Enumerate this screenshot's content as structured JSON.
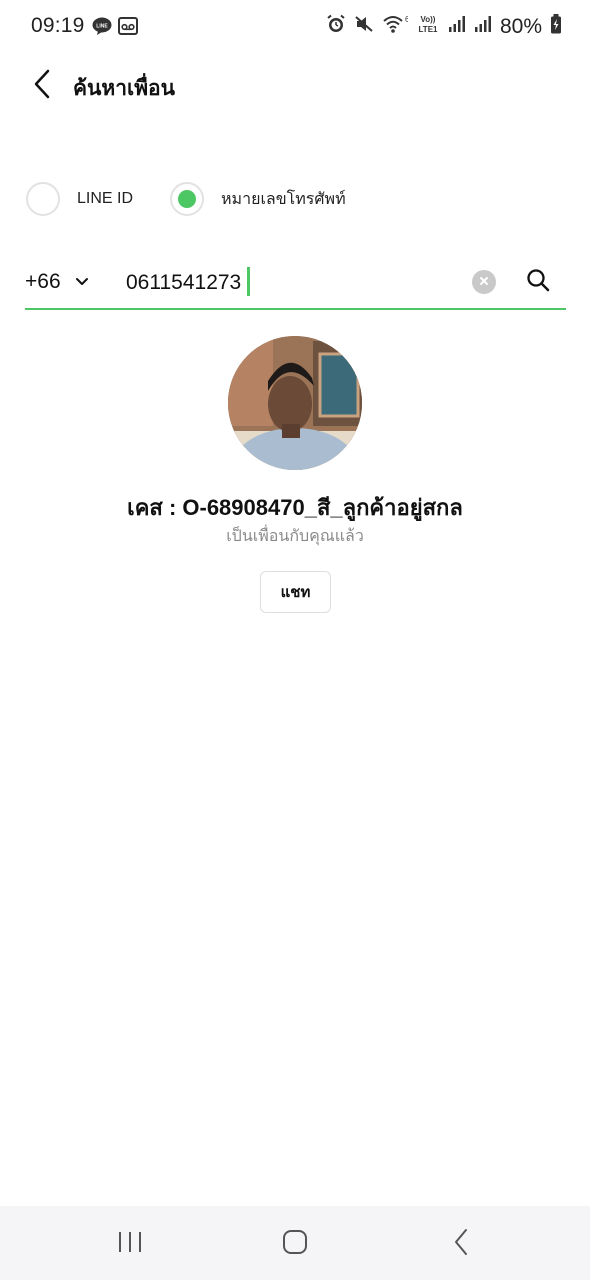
{
  "status_bar": {
    "time": "09:19",
    "battery": "80%",
    "icons": [
      "line-notification-icon",
      "voicemail-icon",
      "alarm-icon",
      "mute-icon",
      "wifi-icon",
      "volte-icon",
      "signal-icon",
      "signal-icon",
      "battery-charging-icon"
    ]
  },
  "header": {
    "title": "ค้นหาเพื่อน"
  },
  "search_type": {
    "options": [
      {
        "label": "LINE ID",
        "selected": false
      },
      {
        "label": "หมายเลขโทรศัพท์",
        "selected": true
      }
    ]
  },
  "search": {
    "country_code": "+66",
    "value": "0611541273"
  },
  "result": {
    "name": "เคส : O-68908470_สี_ลูกค้าอยู่สกล",
    "status": "เป็นเพื่อนกับคุณแล้ว",
    "chat_label": "แชท"
  },
  "colors": {
    "accent": "#4cc764",
    "nav_background": "#f5f5f7"
  }
}
